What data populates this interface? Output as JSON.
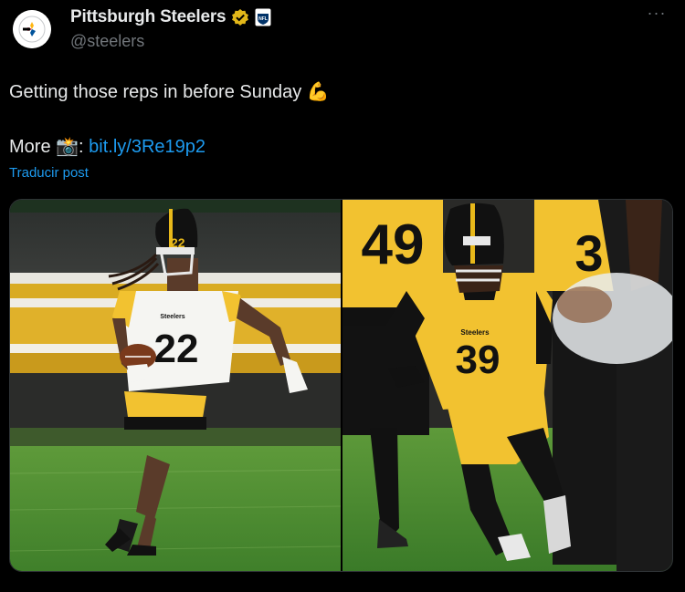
{
  "tweet": {
    "display_name": "Pittsburgh Steelers",
    "handle": "@steelers",
    "verified_badge_icon": "verified-gold-badge-icon",
    "affiliate_badge_icon": "nfl-shield-icon",
    "more_icon": "more-dots-icon",
    "text_line1": "Getting those reps in before Sunday",
    "text_line1_emoji": "💪",
    "text_line2_prefix": "More",
    "text_line2_emoji": "📸",
    "text_line2_colon": ":",
    "link_text": "bit.ly/3Re19p2",
    "translate_label": "Traducir post"
  },
  "media": {
    "photos": [
      {
        "jersey_number": "22",
        "jersey_brand": "Steelers",
        "jersey_color": "white"
      },
      {
        "jersey_number": "39",
        "jersey_brand": "Steelers",
        "jersey_color": "gold",
        "background_numbers": [
          "49",
          "3"
        ]
      }
    ]
  },
  "colors": {
    "background": "#000000",
    "text": "#e7e9ea",
    "secondary_text": "#71767b",
    "link": "#1d9bf0",
    "steelers_gold": "#ffb612",
    "verified_gold": "#e2b719"
  }
}
